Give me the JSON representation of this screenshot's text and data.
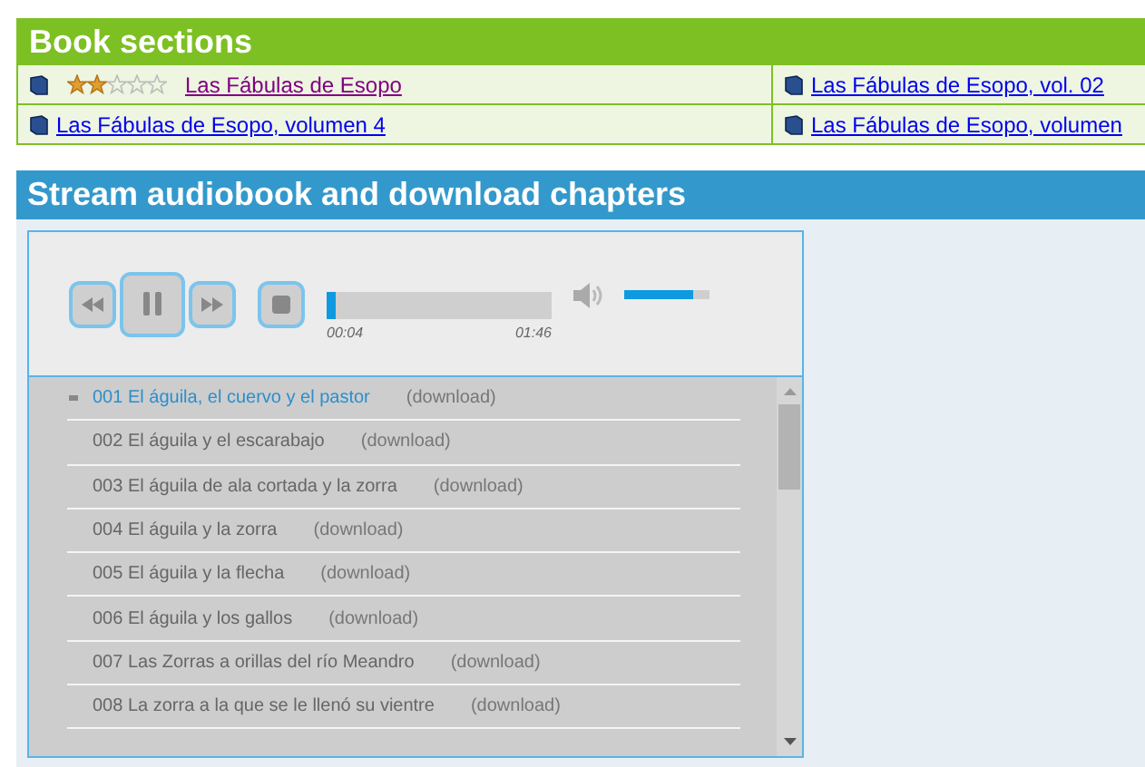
{
  "book_sections": {
    "title": "Book sections",
    "rows": [
      [
        {
          "stars": 2,
          "label": "Las Fábulas de Esopo",
          "visited": true
        },
        {
          "label": "Las Fábulas de Esopo, vol. 02",
          "visited": false
        }
      ],
      [
        {
          "label": "Las Fábulas de Esopo, volumen 4",
          "visited": false
        },
        {
          "label": "Las Fábulas de Esopo, volumen",
          "visited": false
        }
      ]
    ]
  },
  "stream": {
    "title": "Stream audiobook and download chapters",
    "player": {
      "playing": true,
      "progress": {
        "level": 0.04
      },
      "elapsed": "00:04",
      "duration": "01:46",
      "volume": {
        "level": 0.8
      }
    },
    "tracks": [
      {
        "title": "001 El águila, el cuervo y el pastor",
        "download": "(download)",
        "selected": true
      },
      {
        "title": "002 El águila y el escarabajo",
        "download": "(download)",
        "selected": false
      },
      {
        "title": "003 El águila de ala cortada y la zorra",
        "download": "(download)",
        "selected": false
      },
      {
        "title": "004 El águila y la zorra",
        "download": "(download)",
        "selected": false
      },
      {
        "title": "005 El águila y la flecha",
        "download": "(download)",
        "selected": false
      },
      {
        "title": "006 El águila y los gallos",
        "download": "(download)",
        "selected": false
      },
      {
        "title": "007 Las Zorras a orillas del río Meandro",
        "download": "(download)",
        "selected": false
      },
      {
        "title": "008 La zorra a la que se le llenó su vientre",
        "download": "(download)",
        "selected": false
      }
    ]
  }
}
